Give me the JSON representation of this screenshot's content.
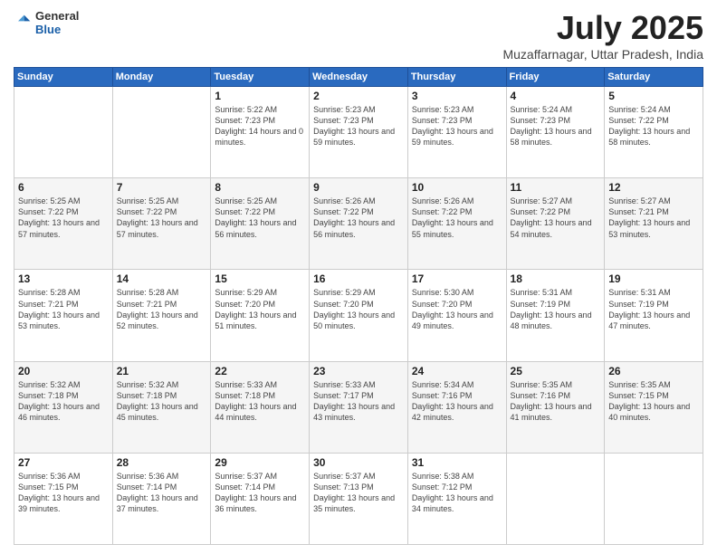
{
  "header": {
    "logo_general": "General",
    "logo_blue": "Blue",
    "month_title": "July 2025",
    "location": "Muzaffarnagar, Uttar Pradesh, India"
  },
  "days_of_week": [
    "Sunday",
    "Monday",
    "Tuesday",
    "Wednesday",
    "Thursday",
    "Friday",
    "Saturday"
  ],
  "weeks": [
    [
      {
        "day": "",
        "sunrise": "",
        "sunset": "",
        "daylight": ""
      },
      {
        "day": "",
        "sunrise": "",
        "sunset": "",
        "daylight": ""
      },
      {
        "day": "1",
        "sunrise": "Sunrise: 5:22 AM",
        "sunset": "Sunset: 7:23 PM",
        "daylight": "Daylight: 14 hours and 0 minutes."
      },
      {
        "day": "2",
        "sunrise": "Sunrise: 5:23 AM",
        "sunset": "Sunset: 7:23 PM",
        "daylight": "Daylight: 13 hours and 59 minutes."
      },
      {
        "day": "3",
        "sunrise": "Sunrise: 5:23 AM",
        "sunset": "Sunset: 7:23 PM",
        "daylight": "Daylight: 13 hours and 59 minutes."
      },
      {
        "day": "4",
        "sunrise": "Sunrise: 5:24 AM",
        "sunset": "Sunset: 7:23 PM",
        "daylight": "Daylight: 13 hours and 58 minutes."
      },
      {
        "day": "5",
        "sunrise": "Sunrise: 5:24 AM",
        "sunset": "Sunset: 7:22 PM",
        "daylight": "Daylight: 13 hours and 58 minutes."
      }
    ],
    [
      {
        "day": "6",
        "sunrise": "Sunrise: 5:25 AM",
        "sunset": "Sunset: 7:22 PM",
        "daylight": "Daylight: 13 hours and 57 minutes."
      },
      {
        "day": "7",
        "sunrise": "Sunrise: 5:25 AM",
        "sunset": "Sunset: 7:22 PM",
        "daylight": "Daylight: 13 hours and 57 minutes."
      },
      {
        "day": "8",
        "sunrise": "Sunrise: 5:25 AM",
        "sunset": "Sunset: 7:22 PM",
        "daylight": "Daylight: 13 hours and 56 minutes."
      },
      {
        "day": "9",
        "sunrise": "Sunrise: 5:26 AM",
        "sunset": "Sunset: 7:22 PM",
        "daylight": "Daylight: 13 hours and 56 minutes."
      },
      {
        "day": "10",
        "sunrise": "Sunrise: 5:26 AM",
        "sunset": "Sunset: 7:22 PM",
        "daylight": "Daylight: 13 hours and 55 minutes."
      },
      {
        "day": "11",
        "sunrise": "Sunrise: 5:27 AM",
        "sunset": "Sunset: 7:22 PM",
        "daylight": "Daylight: 13 hours and 54 minutes."
      },
      {
        "day": "12",
        "sunrise": "Sunrise: 5:27 AM",
        "sunset": "Sunset: 7:21 PM",
        "daylight": "Daylight: 13 hours and 53 minutes."
      }
    ],
    [
      {
        "day": "13",
        "sunrise": "Sunrise: 5:28 AM",
        "sunset": "Sunset: 7:21 PM",
        "daylight": "Daylight: 13 hours and 53 minutes."
      },
      {
        "day": "14",
        "sunrise": "Sunrise: 5:28 AM",
        "sunset": "Sunset: 7:21 PM",
        "daylight": "Daylight: 13 hours and 52 minutes."
      },
      {
        "day": "15",
        "sunrise": "Sunrise: 5:29 AM",
        "sunset": "Sunset: 7:20 PM",
        "daylight": "Daylight: 13 hours and 51 minutes."
      },
      {
        "day": "16",
        "sunrise": "Sunrise: 5:29 AM",
        "sunset": "Sunset: 7:20 PM",
        "daylight": "Daylight: 13 hours and 50 minutes."
      },
      {
        "day": "17",
        "sunrise": "Sunrise: 5:30 AM",
        "sunset": "Sunset: 7:20 PM",
        "daylight": "Daylight: 13 hours and 49 minutes."
      },
      {
        "day": "18",
        "sunrise": "Sunrise: 5:31 AM",
        "sunset": "Sunset: 7:19 PM",
        "daylight": "Daylight: 13 hours and 48 minutes."
      },
      {
        "day": "19",
        "sunrise": "Sunrise: 5:31 AM",
        "sunset": "Sunset: 7:19 PM",
        "daylight": "Daylight: 13 hours and 47 minutes."
      }
    ],
    [
      {
        "day": "20",
        "sunrise": "Sunrise: 5:32 AM",
        "sunset": "Sunset: 7:18 PM",
        "daylight": "Daylight: 13 hours and 46 minutes."
      },
      {
        "day": "21",
        "sunrise": "Sunrise: 5:32 AM",
        "sunset": "Sunset: 7:18 PM",
        "daylight": "Daylight: 13 hours and 45 minutes."
      },
      {
        "day": "22",
        "sunrise": "Sunrise: 5:33 AM",
        "sunset": "Sunset: 7:18 PM",
        "daylight": "Daylight: 13 hours and 44 minutes."
      },
      {
        "day": "23",
        "sunrise": "Sunrise: 5:33 AM",
        "sunset": "Sunset: 7:17 PM",
        "daylight": "Daylight: 13 hours and 43 minutes."
      },
      {
        "day": "24",
        "sunrise": "Sunrise: 5:34 AM",
        "sunset": "Sunset: 7:16 PM",
        "daylight": "Daylight: 13 hours and 42 minutes."
      },
      {
        "day": "25",
        "sunrise": "Sunrise: 5:35 AM",
        "sunset": "Sunset: 7:16 PM",
        "daylight": "Daylight: 13 hours and 41 minutes."
      },
      {
        "day": "26",
        "sunrise": "Sunrise: 5:35 AM",
        "sunset": "Sunset: 7:15 PM",
        "daylight": "Daylight: 13 hours and 40 minutes."
      }
    ],
    [
      {
        "day": "27",
        "sunrise": "Sunrise: 5:36 AM",
        "sunset": "Sunset: 7:15 PM",
        "daylight": "Daylight: 13 hours and 39 minutes."
      },
      {
        "day": "28",
        "sunrise": "Sunrise: 5:36 AM",
        "sunset": "Sunset: 7:14 PM",
        "daylight": "Daylight: 13 hours and 37 minutes."
      },
      {
        "day": "29",
        "sunrise": "Sunrise: 5:37 AM",
        "sunset": "Sunset: 7:14 PM",
        "daylight": "Daylight: 13 hours and 36 minutes."
      },
      {
        "day": "30",
        "sunrise": "Sunrise: 5:37 AM",
        "sunset": "Sunset: 7:13 PM",
        "daylight": "Daylight: 13 hours and 35 minutes."
      },
      {
        "day": "31",
        "sunrise": "Sunrise: 5:38 AM",
        "sunset": "Sunset: 7:12 PM",
        "daylight": "Daylight: 13 hours and 34 minutes."
      },
      {
        "day": "",
        "sunrise": "",
        "sunset": "",
        "daylight": ""
      },
      {
        "day": "",
        "sunrise": "",
        "sunset": "",
        "daylight": ""
      }
    ]
  ]
}
